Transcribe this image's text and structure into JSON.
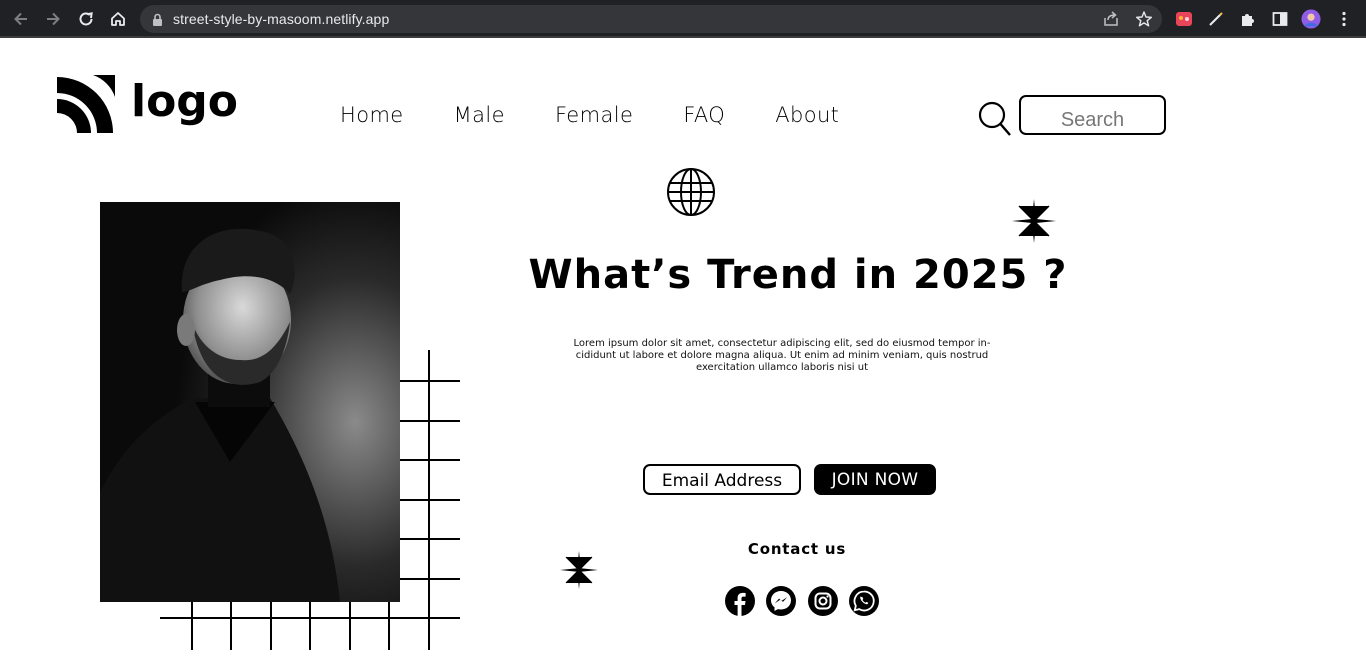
{
  "browser": {
    "url": "street-style-by-masoom.netlify.app"
  },
  "header": {
    "logo_text": "logo",
    "nav": [
      {
        "label": "Home"
      },
      {
        "label": "Male"
      },
      {
        "label": "Female"
      },
      {
        "label": "FAQ"
      },
      {
        "label": "About"
      }
    ],
    "search_placeholder": "Search"
  },
  "hero": {
    "headline": "What’s Trend in 2025 ?",
    "body": "Lorem ipsum dolor sit amet, consectetur adipiscing elit, sed do eiusmod tempor in-cididunt ut labore et dolore magna aliqua. Ut enim ad minim veniam, quis nostrud exercitation ullamco laboris nisi ut",
    "email_placeholder": "Email Address",
    "join_label": "JOIN NOW"
  },
  "contact": {
    "title": "Contact us",
    "icons": [
      "facebook-icon",
      "messenger-icon",
      "instagram-icon",
      "whatsapp-icon"
    ]
  },
  "colors": {
    "chrome_bg": "#202124",
    "omnibox_bg": "#35363a",
    "accent": "#000000",
    "page_bg": "#ffffff"
  }
}
